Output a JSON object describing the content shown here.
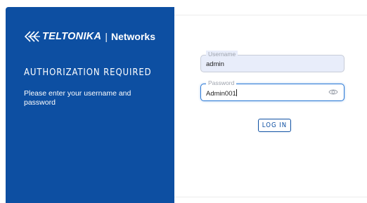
{
  "brand": {
    "logo_icon": "teltonika-chevrons-icon",
    "name": "TELTONIKA",
    "separator": "|",
    "product": "Networks"
  },
  "auth": {
    "title": "AUTHORIZATION REQUIRED",
    "description": "Please enter your username and password"
  },
  "form": {
    "username_label": "Username",
    "username_value": "admin",
    "password_label": "Password",
    "password_value": "Admin001",
    "password_toggle_icon": "eye-icon",
    "login_label": "LOG IN"
  },
  "colors": {
    "brand_blue": "#0d4fa2",
    "focus_border": "#2d7ad6",
    "autofill_bg": "#e8edfa"
  }
}
